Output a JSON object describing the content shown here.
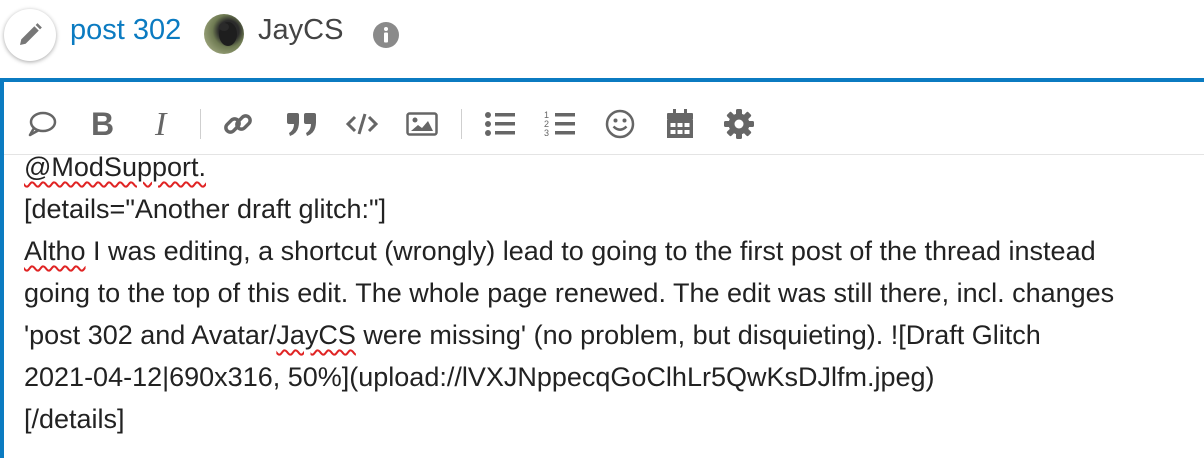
{
  "header": {
    "post_label": "post 302",
    "username": "JayCS"
  },
  "toolbar": {
    "buttons": [
      "quote-icon",
      "bold-icon",
      "italic-icon",
      "link-icon",
      "blockquote-icon",
      "code-icon",
      "image-icon",
      "bullet-list-icon",
      "numbered-list-icon",
      "emoji-icon",
      "calendar-icon",
      "gear-icon"
    ]
  },
  "editor": {
    "line0": "@ModSupport.",
    "line1": "[details=\"Another draft glitch:\"]",
    "line2_word": "Altho",
    "line2_rest": " I was editing, a shortcut (wrongly) lead to going to the first post of the thread instead",
    "line3": "going to the top of this edit. The whole page renewed. The edit was still there, incl. changes",
    "line4_pre": "'post 302 and Avatar/",
    "line4_word": "JayCS",
    "line4_post": " were missing' (no problem, but disquieting). ![Draft Glitch",
    "line5": "2021-04-12|690x316, 50%](upload://lVXJNppecqGoClhLr5QwKsDJlfm.jpeg)",
    "line6": "[/details]"
  },
  "colors": {
    "accent": "#0b7bc1",
    "spellcheck": "#e02424",
    "icon": "#666666"
  }
}
